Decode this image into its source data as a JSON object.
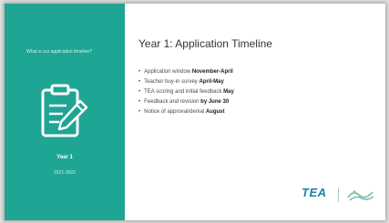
{
  "sidebar": {
    "subtitle": "What is our application timeline?",
    "year": "Year 1",
    "range": "2021-2022"
  },
  "main": {
    "title": "Year 1: Application Timeline",
    "bullets": [
      {
        "text": "Application window ",
        "bold": "November-April"
      },
      {
        "text": "Teacher buy-in survey ",
        "bold": "April-May"
      },
      {
        "text": "TEA scoring and initial feedback ",
        "bold": "May"
      },
      {
        "text": "Feedback and revision ",
        "bold": "by June 30"
      },
      {
        "text": "Notice of approval/denial ",
        "bold": "August"
      }
    ]
  },
  "logo": {
    "text": "TEA"
  },
  "colors": {
    "accent": "#1fa594",
    "brand": "#1b7fa5"
  },
  "icons": [
    "clipboard-icon",
    "pencil-icon",
    "emblem-icon"
  ]
}
